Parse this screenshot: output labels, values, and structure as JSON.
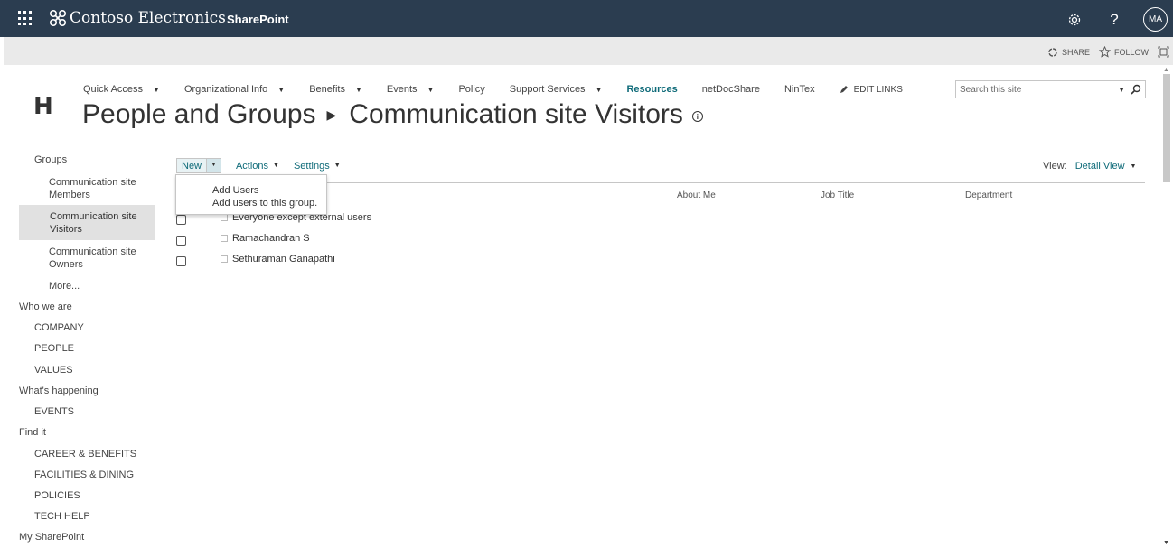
{
  "suite": {
    "brand": "Contoso Electronics",
    "app": "SharePoint",
    "avatar_initials": "MA"
  },
  "ribbon": {
    "share_label": "SHARE",
    "follow_label": "FOLLOW"
  },
  "site": {
    "logo_letter": "H",
    "topnav": [
      {
        "label": "Quick Access",
        "has_menu": true
      },
      {
        "label": "Organizational Info",
        "has_menu": true
      },
      {
        "label": "Benefits",
        "has_menu": true
      },
      {
        "label": "Events",
        "has_menu": true
      },
      {
        "label": "Policy",
        "has_menu": false
      },
      {
        "label": "Support Services",
        "has_menu": true
      },
      {
        "label": "Resources",
        "has_menu": false,
        "active": true
      },
      {
        "label": "netDocShare",
        "has_menu": false
      },
      {
        "label": "NinTex",
        "has_menu": false
      }
    ],
    "edit_links_label": "EDIT LINKS",
    "search_placeholder": "Search this site"
  },
  "title": {
    "parent": "People and Groups",
    "current": "Communication site Visitors"
  },
  "leftnav": {
    "groups_heading": "Groups",
    "groups": [
      {
        "line1": "Communication site",
        "line2": "Members"
      },
      {
        "line1": "Communication site",
        "line2": "Visitors",
        "selected": true
      },
      {
        "line1": "Communication site",
        "line2": "Owners"
      }
    ],
    "more": "More...",
    "who_we_are": "Who we are",
    "company": "COMPANY",
    "people": "PEOPLE",
    "values": "VALUES",
    "whats_happening": "What's happening",
    "events": "EVENTS",
    "find_it": "Find it",
    "career": "CAREER & BENEFITS",
    "facilities": "FACILITIES & DINING",
    "policies": "POLICIES",
    "tech_help": "TECH HELP",
    "my_sharepoint": "My SharePoint"
  },
  "toolbar": {
    "new_label": "New",
    "actions_label": "Actions",
    "settings_label": "Settings",
    "view_label": "View:",
    "view_value": "Detail View"
  },
  "menu": {
    "title": "Add Users",
    "description": "Add users to this group."
  },
  "table": {
    "columns": {
      "about": "About Me",
      "job": "Job Title",
      "department": "Department"
    },
    "rows": [
      {
        "name": "Everyone except external users"
      },
      {
        "name": "Ramachandran S"
      },
      {
        "name": "Sethuraman Ganapathi"
      }
    ]
  },
  "colors": {
    "suitebar": "#2b3d50",
    "accent": "#0f6b79"
  }
}
